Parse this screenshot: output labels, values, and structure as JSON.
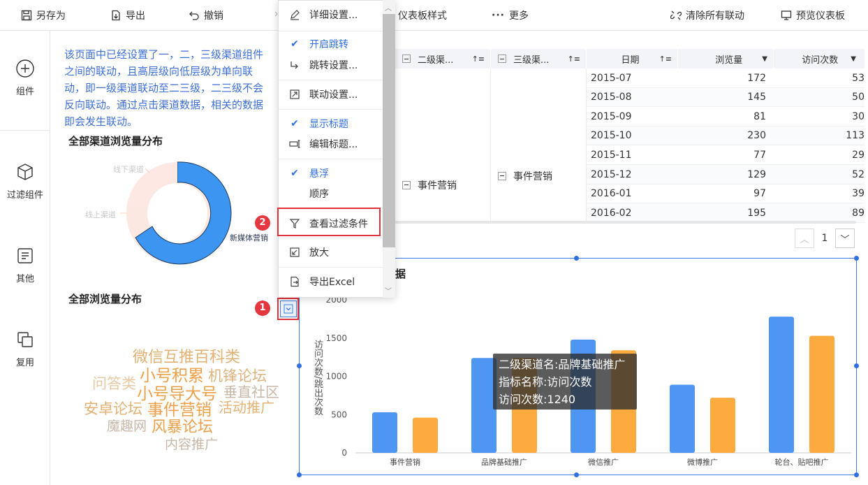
{
  "toolbar": {
    "save_as": "另存为",
    "export": "导出",
    "undo": "撤销",
    "dashboard_style": "仪表板样式",
    "more": "更多",
    "clear_links": "清除所有联动",
    "preview": "预览仪表板"
  },
  "sidebar": {
    "items": [
      {
        "label": "组件"
      },
      {
        "label": "过滤组件"
      },
      {
        "label": "其他"
      },
      {
        "label": "复用"
      }
    ]
  },
  "canvas": {
    "note": "该页面中已经设置了一，二，三级渠道组件之间的联动，且高层级向低层级为单向联动，即一级渠道联动至二三级，二三级不会反向联动。通过点击渠道数据，相关的数据即会发生联动。",
    "donut_title": "全部渠道浏览量分布",
    "donut_labels": {
      "offline": "线下渠道",
      "online": "线上渠道",
      "newmedia": "新媒体营销"
    },
    "wordcloud_title": "全部浏览量分布",
    "wordcloud": [
      {
        "text": "微信互推百科类",
        "color": "#e3b173"
      },
      {
        "text": "问答类",
        "color": "#e7c9a3"
      },
      {
        "text": "小号积累",
        "color": "#eba049"
      },
      {
        "text": "机锋论坛",
        "color": "#dcb37c"
      },
      {
        "text": "小号导大号",
        "color": "#eba049"
      },
      {
        "text": "垂直社区",
        "color": "#c8b7a6"
      },
      {
        "text": "安卓论坛",
        "color": "#e3b173"
      },
      {
        "text": "事件营销",
        "color": "#eba049"
      },
      {
        "text": "活动推广",
        "color": "#e3b173"
      },
      {
        "text": "魔趣网",
        "color": "#c8b7a6"
      },
      {
        "text": "风暴论坛",
        "color": "#eba049"
      },
      {
        "text": "内容推广",
        "color": "#c8b7a6"
      }
    ]
  },
  "table": {
    "headers": [
      "二级渠...",
      "三级渠...",
      "日期",
      "浏览量",
      "访问次数"
    ],
    "merged_level2": "事件营销",
    "merged_level3": "事件营销",
    "rows": [
      {
        "date": "2015-07",
        "views": "172",
        "visits": "53"
      },
      {
        "date": "2015-08",
        "views": "145",
        "visits": "50"
      },
      {
        "date": "2015-09",
        "views": "81",
        "visits": "30"
      },
      {
        "date": "2015-10",
        "views": "230",
        "visits": "113"
      },
      {
        "date": "2015-11",
        "views": "77",
        "visits": "29"
      },
      {
        "date": "2015-12",
        "views": "129",
        "visits": "52"
      },
      {
        "date": "2016-01",
        "views": "97",
        "visits": "39"
      },
      {
        "date": "2016-02",
        "views": "195",
        "visits": "89"
      }
    ],
    "page": "1"
  },
  "menu": {
    "items": [
      {
        "label": "详细设置...",
        "icon": "pencil-icon",
        "checked": false
      },
      {
        "label": "开启跳转",
        "icon": "check-icon",
        "checked": true
      },
      {
        "label": "跳转设置...",
        "icon": "jump-icon",
        "checked": false
      },
      {
        "label": "联动设置...",
        "icon": "link-icon",
        "checked": false
      },
      {
        "label": "显示标题",
        "icon": "check-icon",
        "checked": true
      },
      {
        "label": "编辑标题...",
        "icon": "edit-title-icon",
        "checked": false
      },
      {
        "label": "悬浮",
        "icon": "check-icon",
        "checked": true
      },
      {
        "label": "顺序",
        "icon": "",
        "checked": false
      },
      {
        "label": "查看过滤条件",
        "icon": "filter-icon",
        "checked": false
      },
      {
        "label": "放大",
        "icon": "zoom-icon",
        "checked": false
      },
      {
        "label": "导出Excel",
        "icon": "export-icon",
        "checked": false
      }
    ]
  },
  "annotations": {
    "badge1": "1",
    "badge2": "2"
  },
  "bar_widget": {
    "partial_title": "据",
    "tooltip": {
      "line1": "二级渠道名:品牌基础推广",
      "line2": "指标名称:访问次数",
      "line3": "访问次数:1240"
    }
  },
  "chart_data": {
    "type": "bar",
    "categories": [
      "事件营销",
      "品牌基础推广",
      "微信推广",
      "微博推广",
      "轮台、贴吧推广"
    ],
    "series": [
      {
        "values": [
          530,
          1240,
          1480,
          890,
          1780
        ],
        "color": "#4e96f2"
      },
      {
        "values": [
          460,
          1240,
          1340,
          720,
          1530
        ],
        "color": "#fdab3f"
      }
    ],
    "ylabel": "访问次数/跳出次数",
    "ylim": [
      0,
      2000
    ],
    "yticks": [
      "0",
      "500",
      "1000",
      "1500",
      "2000"
    ]
  },
  "colors": {
    "accent": "#2f6fe0",
    "note": "#3d6fd6",
    "highlight": "#e0323a"
  }
}
